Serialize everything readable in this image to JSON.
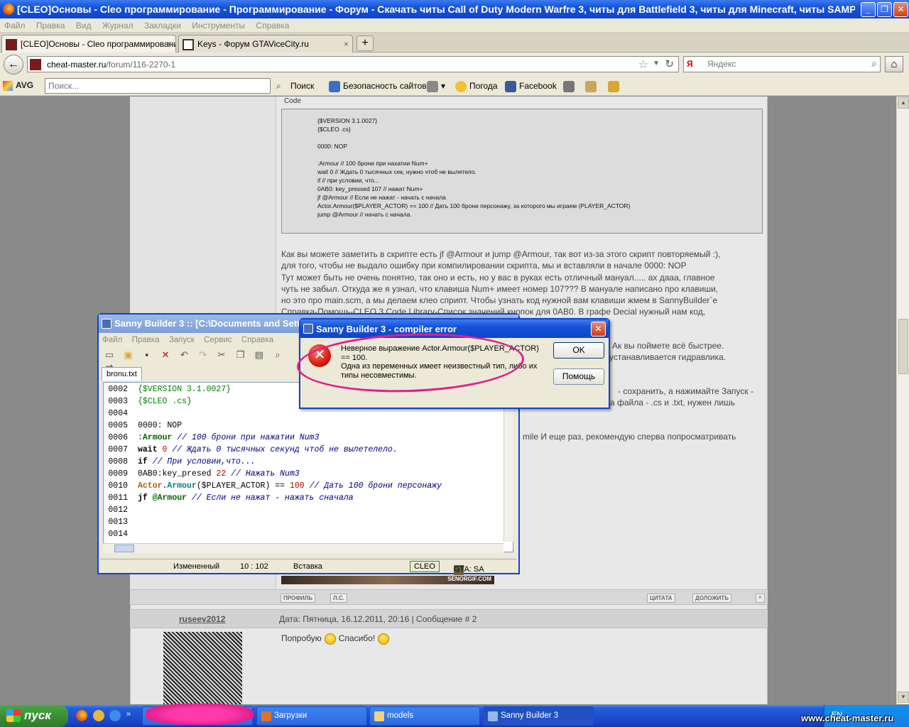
{
  "browser": {
    "window_title": "[CLEO]Основы - Cleo программирование - Программирование - Форум - Скачать читы Call of Duty Modern Warfre 3, читы для Battlefield 3, читы для Minecraft, читы SAMP, CS 1.6,CSS ...",
    "menu": [
      "Файл",
      "Правка",
      "Вид",
      "Журнал",
      "Закладки",
      "Инструменты",
      "Справка"
    ],
    "tabs": [
      {
        "label": "[CLEO]Основы - Cleo программировани...",
        "close": "×"
      },
      {
        "label": "Keys - Форум GTAViceCity.ru",
        "close": "×"
      }
    ],
    "new_tab": "+",
    "url_host": "cheat-master.ru",
    "url_path": "/forum/116-2270-1",
    "search_engine_badge": "Я",
    "search_placeholder": "Яндекс",
    "avg": {
      "logo": "AVG",
      "search_placeholder": "Поиск...",
      "search_label": "Поиск",
      "safe_sites": "Безопасность сайтов",
      "weather": "Погода",
      "facebook": "Facebook"
    }
  },
  "post": {
    "code_label": "Code",
    "code_lines": [
      "{$VERSION 3.1.0027}",
      "{$CLEO .cs}",
      "",
      "0000: NOP",
      "",
      ":Armour // 100 брони при нахатии Num+",
      "wait 0 // Ждать 0 тысячных сек, нужно чтоб не вылетело.",
      "if  // при условии, что...",
      "0AB0: key_pressed 107 // нажат Num+",
      "jf @Armour // Если не нажат - начать с начала",
      "Actor.Armour($PLAYER_ACTOR) == 100 // Дать 100 брони персонажу, за которого мы играем (PLAYER_ACTOR)",
      "jump @Armour // начать с начала."
    ],
    "text_lines": [
      "Как вы можете заметить в скрипте есть jf @Armour и jump @Armour, так вот из-за этого скрипт повторяемый :),",
      "для того, чтобы не выдало ошибку при компилировании скрипта, мы и вставляли в начале 0000: NOP",
      "Тут может быть не очень понятно, так оно и есть, но у вас в руках есть отличный мануал..... ах дааа, главное",
      "чуть не забыл. Откуда же я узнал, что клавиша Num+ имеет номер 107??? В мануале написано про клавиши,",
      "но это про main.scm, а мы делаем клео сприпт. Чтобы узнать код нужной вам клавиши жмем в SannyBuilder`e",
      "Справка-Помощь-CLEO 3 Code Library-Список значений кнопок для 0AB0. В графе Decial нужный нам код,"
    ],
    "fragment_1": "Ак вы поймете всё быстрее.",
    "fragment_2": "устанавливается гидравлика.",
    "fragment_3": "- сохранить, а нажимайте Запуск -",
    "fragment_4": "а файла - .cs и .txt, нужен лишь",
    "fragment_5": "mile И еще раз, рекомендую сперва попросматривать",
    "gif_caption": "SENORGIF.COM",
    "buttons": {
      "profile": "ПРОФИЛЬ",
      "pm": "Л.С.",
      "quote": "ЦИТАТА",
      "report": "ДОЛОЖИТЬ",
      "top": "^"
    }
  },
  "reply": {
    "username": "ruseev2012",
    "meta": "Дата: Пятница, 16.12.2011, 20:16 | Сообщение #",
    "number": "2",
    "text_before": "Попробую",
    "text_after": "Спасибо!"
  },
  "sanny": {
    "title": "Sanny Builder 3 :: [C:\\Documents and Setti",
    "menu": [
      "Файл",
      "Правка",
      "Запуск",
      "Сервис",
      "Справка"
    ],
    "file_tab": "bronu.txt",
    "lines": [
      {
        "n": "0002",
        "parts": [
          {
            "t": "{$VERSION 3.1.0027}",
            "c": "c-green"
          }
        ]
      },
      {
        "n": "0003",
        "parts": [
          {
            "t": "{$CLEO .cs}",
            "c": "c-green"
          }
        ]
      },
      {
        "n": "0004",
        "parts": []
      },
      {
        "n": "0005",
        "parts": [
          {
            "t": "0000: NOP",
            "c": ""
          }
        ]
      },
      {
        "n": "0006",
        "parts": [
          {
            "t": ":Armour",
            "c": "c-lbl"
          },
          {
            "t": " // 100 брони при нажатии Num3",
            "c": "c-cm"
          }
        ]
      },
      {
        "n": "0007",
        "parts": [
          {
            "t": "wait",
            "c": "c-kw"
          },
          {
            "t": " 0",
            "c": "c-num"
          },
          {
            "t": " // Ждать 0 тысячных секунд чтоб не вылетелело.",
            "c": "c-cm"
          }
        ]
      },
      {
        "n": "0008",
        "parts": [
          {
            "t": "if",
            "c": "c-kw"
          },
          {
            "t": " // При условии,что...",
            "c": "c-cm"
          }
        ]
      },
      {
        "n": "0009",
        "parts": [
          {
            "t": "0AB0:key_presed ",
            "c": ""
          },
          {
            "t": "22",
            "c": "c-num"
          },
          {
            "t": " // Нажать Num3",
            "c": "c-cm"
          }
        ]
      },
      {
        "n": "0010",
        "parts": [
          {
            "t": "Actor",
            "c": "c-cls"
          },
          {
            "t": ".",
            "c": ""
          },
          {
            "t": "Armour",
            "c": "c-mth"
          },
          {
            "t": "($PLAYER_ACTOR) == ",
            "c": ""
          },
          {
            "t": "100",
            "c": "c-num"
          },
          {
            "t": " // Дать 100 брони персонажу",
            "c": "c-cm"
          }
        ]
      },
      {
        "n": "0011",
        "parts": [
          {
            "t": "jf",
            "c": "c-kw"
          },
          {
            "t": " @Armour",
            "c": "c-lbl"
          },
          {
            "t": " // Если не нажат - нажать сначала",
            "c": "c-cm"
          }
        ]
      },
      {
        "n": "0012",
        "parts": []
      },
      {
        "n": "0013",
        "parts": []
      },
      {
        "n": "0014",
        "parts": []
      }
    ],
    "status": {
      "modified": "Измененный",
      "position": "10 : 102",
      "mode": "Вставка",
      "lang": "CLEO",
      "game": "GTA: SA"
    }
  },
  "dialog": {
    "title": "Sanny Builder 3 - compiler error",
    "message": "Неверное выражение Actor.Armour($PLAYER_ACTOR)\n== 100.\nОдна из переменных имеет неизвестный тип, либо их\nтипы несовместимы.",
    "ok": "OK",
    "help": "Помощь",
    "close": "✕"
  },
  "taskbar": {
    "start": "пуск",
    "tasks": [
      "Загрузки",
      "models",
      "Sanny Builder 3"
    ],
    "lang": "EN",
    "watermark": "www.cheat-master.ru"
  },
  "colors": {
    "xp_blue": "#0b45d1",
    "scribble": "#e0208a",
    "start_green": "#3c8f37"
  }
}
